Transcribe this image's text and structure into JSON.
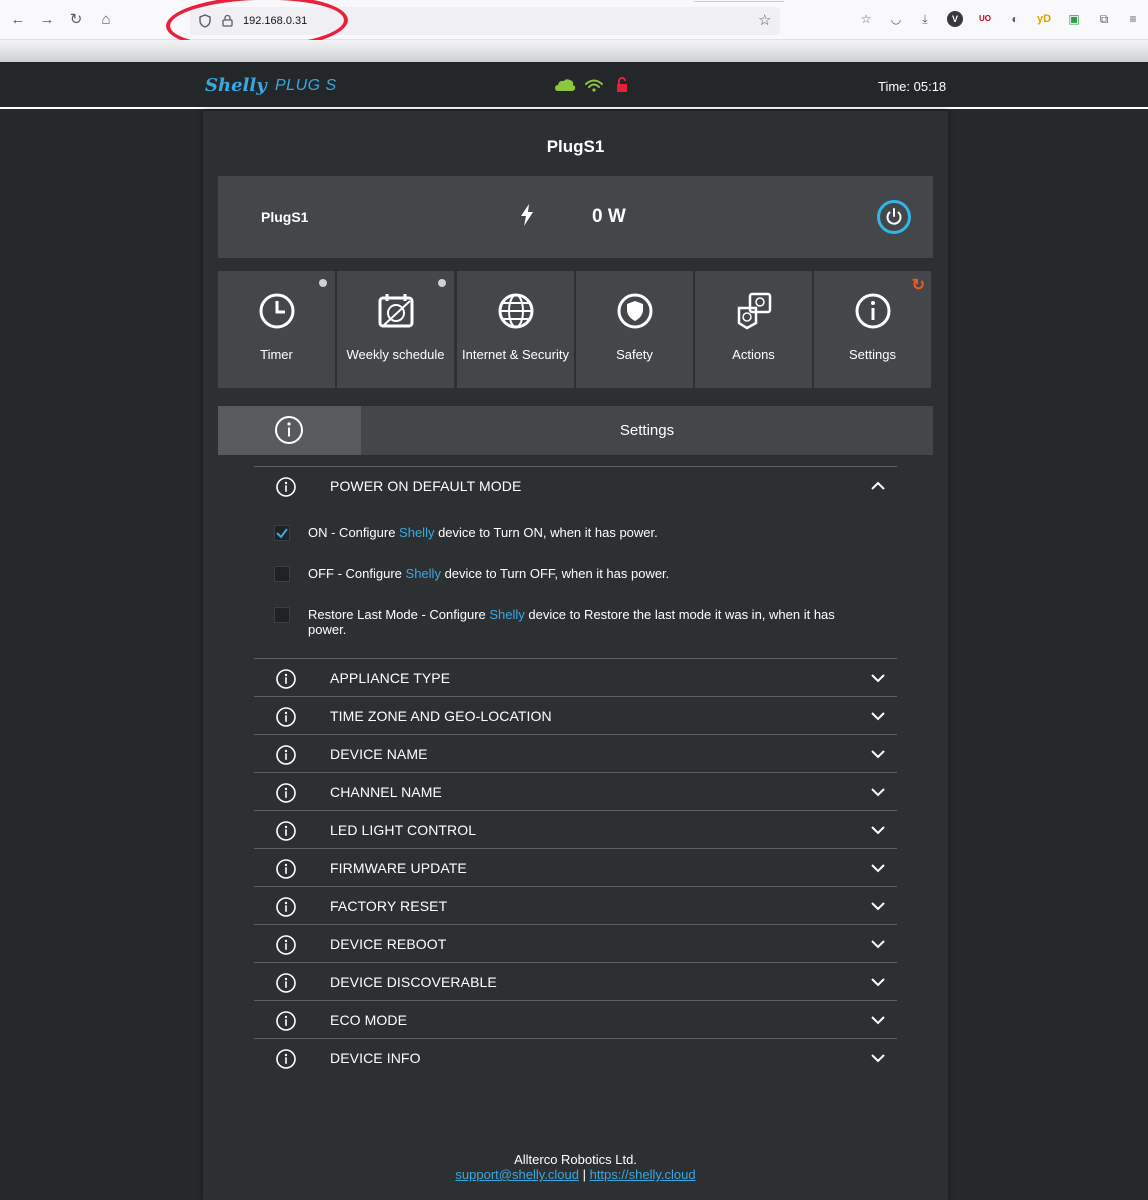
{
  "browser": {
    "url": "192.168.0.31",
    "extensions": [
      "V",
      "UO",
      "yD"
    ]
  },
  "header": {
    "logo": "Shelly",
    "logo_sub": "PLUG S",
    "time": "Time: 05:18",
    "icons": [
      "cloud-icon",
      "wifi-icon",
      "lock-icon"
    ]
  },
  "page": {
    "title": "PlugS1"
  },
  "device": {
    "name": "PlugS1",
    "power": "0 W"
  },
  "tiles": [
    {
      "label": "Timer",
      "icon": "clock-icon"
    },
    {
      "label": "Weekly schedule",
      "icon": "calendar-icon"
    },
    {
      "label": "Internet & Security",
      "icon": "globe-icon"
    },
    {
      "label": "Safety",
      "icon": "shield-icon"
    },
    {
      "label": "Actions",
      "icon": "actions-icon"
    },
    {
      "label": "Settings",
      "icon": "info-icon"
    }
  ],
  "settings_bar": {
    "title": "Settings"
  },
  "power_on_default": {
    "title": "POWER ON DEFAULT MODE",
    "options": [
      {
        "pre": "ON - Configure ",
        "brand": "Shelly",
        "post": " device to Turn ON, when it has power.",
        "checked": true
      },
      {
        "pre": "OFF - Configure ",
        "brand": "Shelly",
        "post": " device to Turn OFF, when it has power.",
        "checked": false
      },
      {
        "pre": "Restore Last Mode - Configure ",
        "brand": "Shelly",
        "post": " device to Restore the last mode it was in, when it has power.",
        "checked": false
      }
    ]
  },
  "sections": [
    "APPLIANCE TYPE",
    "TIME ZONE AND GEO-LOCATION",
    "DEVICE NAME",
    "CHANNEL NAME",
    "LED LIGHT CONTROL",
    "FIRMWARE UPDATE",
    "FACTORY RESET",
    "DEVICE REBOOT",
    "DEVICE DISCOVERABLE",
    "ECO MODE",
    "DEVICE INFO"
  ],
  "footer": {
    "company": "Allterco Robotics Ltd.",
    "email": "support@shelly.cloud",
    "separator": "|",
    "site": "https://shelly.cloud"
  },
  "colors": {
    "accent": "#3aa8e0",
    "cloud": "#8cc63f",
    "lock": "#e8203a",
    "refresh": "#f05a1a"
  }
}
